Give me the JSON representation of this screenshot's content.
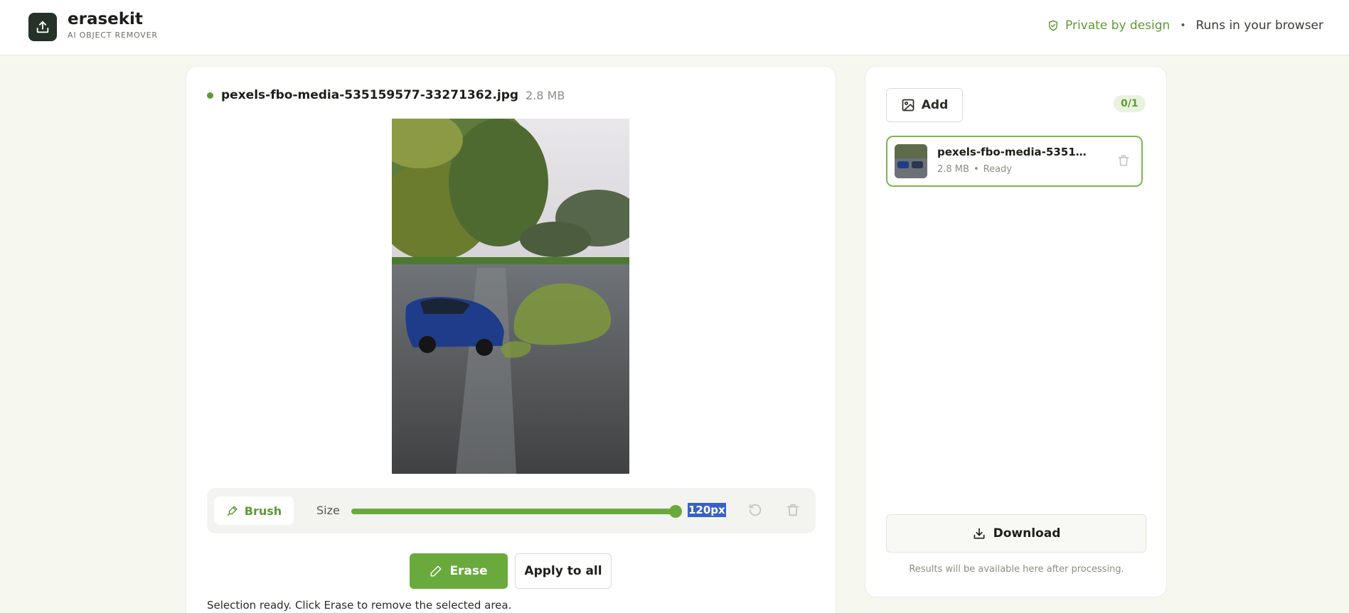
{
  "header": {
    "brand_name": "erasekit",
    "brand_tagline": "AI OBJECT REMOVER",
    "privacy_label": "Private by design",
    "separator": "•",
    "runtime_label": "Runs in your browser"
  },
  "editor": {
    "file_name": "pexels-fbo-media-535159577-33271362.jpg",
    "file_size": "2.8 MB",
    "toolbar": {
      "brush_label": "Brush",
      "size_label": "Size",
      "size_value": "120px",
      "size_fraction": 1.0
    },
    "erase_label": "Erase",
    "apply_all_label": "Apply to all",
    "status_message": "Selection ready. Click Erase to remove the selected area."
  },
  "queue": {
    "add_label": "Add",
    "count": "0/1",
    "items": [
      {
        "name": "pexels-fbo-media-535159...",
        "size": "2.8 MB",
        "separator": "•",
        "status": "Ready"
      }
    ],
    "download_label": "Download",
    "results_note": "Results will be available here after processing."
  },
  "colors": {
    "accent_green": "#6aaa3c",
    "brand_dark": "#243227",
    "selection_highlight": "#3760c8"
  }
}
